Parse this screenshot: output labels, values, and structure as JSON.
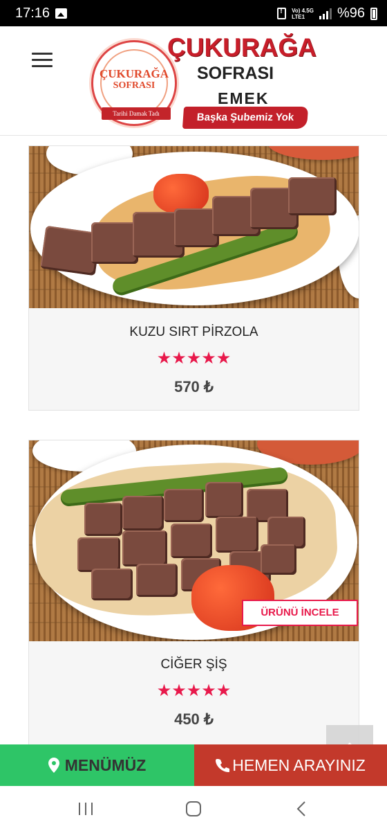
{
  "status_bar": {
    "time": "17:16",
    "network": "Vo) 4.5G",
    "network_sub": "LTE1",
    "battery": "%96"
  },
  "header": {
    "logo": {
      "badge_line1": "ÇUKURAĞA",
      "badge_line2": "SOFRASI",
      "badge_ribbon": "Tarihi Damak Tadı",
      "title": "ÇUKURAĞA",
      "subtitle": "SOFRASI",
      "branch_name": "EMEK",
      "branch_note": "Başka Şubemiz Yok"
    }
  },
  "products": [
    {
      "name": "KUZU SIRT PİRZOLA",
      "rating": "★★★★★",
      "price": "570 ₺"
    },
    {
      "name": "CİĞER ŞİŞ",
      "rating": "★★★★★",
      "price": "450 ₺",
      "review_label": "ÜRÜNÜ İNCELE"
    }
  ],
  "bottom_bar": {
    "menu_label": "MENÜMÜZ",
    "call_label": "HEMEN ARAYINIZ"
  },
  "colors": {
    "accent": "#e8194b",
    "menu_green": "#2ec567",
    "call_red": "#c3392b",
    "brand_red": "#c81e2a"
  }
}
